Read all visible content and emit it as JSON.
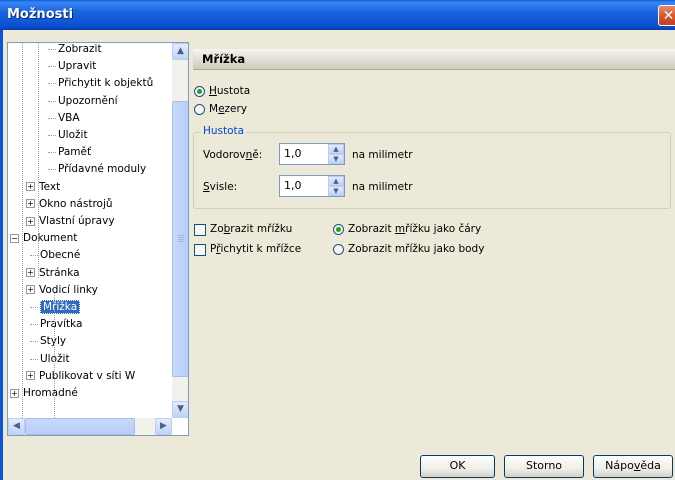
{
  "window": {
    "title": "Možnosti",
    "close_glyph": "✕"
  },
  "tree": {
    "items": [
      {
        "label": "Zobrazit",
        "level": 2,
        "expander": ""
      },
      {
        "label": "Upravit",
        "level": 2,
        "expander": ""
      },
      {
        "label": "Přichytit k objektů",
        "level": 2,
        "expander": ""
      },
      {
        "label": "Upozornění",
        "level": 2,
        "expander": ""
      },
      {
        "label": "VBA",
        "level": 2,
        "expander": ""
      },
      {
        "label": "Uložit",
        "level": 2,
        "expander": ""
      },
      {
        "label": "Paměť",
        "level": 2,
        "expander": ""
      },
      {
        "label": "Přídavné moduly",
        "level": 2,
        "expander": ""
      },
      {
        "label": "Text",
        "level": 1,
        "expander": "+"
      },
      {
        "label": "Okno nástrojů",
        "level": 1,
        "expander": "+"
      },
      {
        "label": "Vlastní úpravy",
        "level": 1,
        "expander": "+"
      },
      {
        "label": "Dokument",
        "level": 0,
        "expander": "−"
      },
      {
        "label": "Obecné",
        "level": 1,
        "expander": ""
      },
      {
        "label": "Stránka",
        "level": 1,
        "expander": "+"
      },
      {
        "label": "Vodicí linky",
        "level": 1,
        "expander": "+"
      },
      {
        "label": "Mřížka",
        "level": 1,
        "expander": "",
        "selected": true
      },
      {
        "label": "Pravítka",
        "level": 1,
        "expander": ""
      },
      {
        "label": "Styly",
        "level": 1,
        "expander": ""
      },
      {
        "label": "Uložit",
        "level": 1,
        "expander": ""
      },
      {
        "label": "Publikovat v síti W",
        "level": 1,
        "expander": "+"
      },
      {
        "label": "Hromadné",
        "level": 0,
        "expander": "+"
      }
    ],
    "scroll_up": "▲",
    "scroll_down": "▼",
    "scroll_left": "◀",
    "scroll_right": "▶"
  },
  "panel": {
    "header": "Mřížka",
    "mode": {
      "density_pre": "",
      "density_u": "H",
      "density_post": "ustota",
      "spacing_pre": "M",
      "spacing_u": "e",
      "spacing_post": "zery",
      "selected": "density"
    },
    "group": {
      "title": "Hustota",
      "horizontal_pre": "Vodorov",
      "horizontal_u": "n",
      "horizontal_post": "ě:",
      "horizontal_value": "1,0",
      "vertical_pre": "",
      "vertical_u": "S",
      "vertical_post": "visle:",
      "vertical_value": "1,0",
      "unit": "na  milimetr"
    },
    "options": {
      "show_grid_pre": "Zo",
      "show_grid_u": "b",
      "show_grid_post": "razit mřížku",
      "snap_grid_pre": "P",
      "snap_grid_u": "ř",
      "snap_grid_post": "ichytit k mřížce",
      "as_lines_pre": "Zobrazit ",
      "as_lines_u": "m",
      "as_lines_post": "řížku jako čáry",
      "as_dots": "Zobrazit mřížku jako body",
      "show_grid_checked": false,
      "snap_grid_checked": false,
      "display_selected": "lines"
    }
  },
  "buttons": {
    "ok": "OK",
    "cancel": "Storno",
    "help_pre": "Nápo",
    "help_u": "v",
    "help_post": "ěda"
  }
}
